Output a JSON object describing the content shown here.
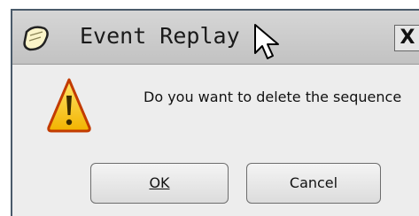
{
  "window": {
    "title": "Event Replay",
    "close_label": "X"
  },
  "dialog": {
    "message": "Do you want to delete the sequence",
    "ok_label": "OK",
    "cancel_label": "Cancel"
  },
  "icons": {
    "app": "clipboard-icon",
    "warning": "warning-icon",
    "cursor": "mouse-cursor-icon"
  },
  "colors": {
    "warning_fill": "#f2c200",
    "warning_border": "#c23b00",
    "titlebar": "#c8c8c8",
    "dialog_bg": "#ededed"
  }
}
